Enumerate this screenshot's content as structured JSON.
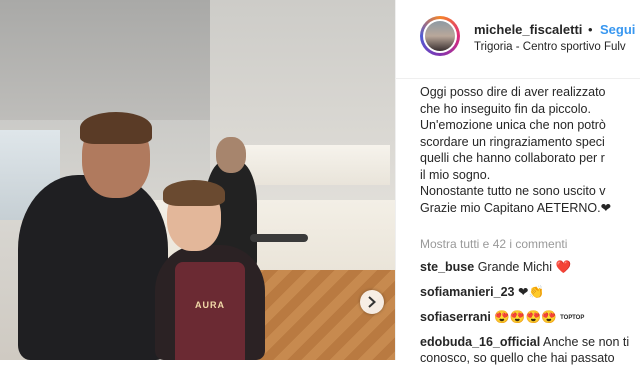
{
  "post": {
    "photo": {
      "shirt_text": "AURA",
      "next_icon": "chevron-right-icon"
    },
    "header": {
      "username": "michele_fiscaletti",
      "separator": "•",
      "follow_label": "Segui",
      "location": "Trigoria - Centro sportivo Fulv"
    },
    "caption": {
      "lines": [
        "Oggi posso dire di aver realizzato",
        "che ho inseguito fin da piccolo.",
        "Un'emozione unica che non potrò",
        "scordare un ringraziamento speci",
        "quelli che hanno collaborato per r",
        "il mio sogno.",
        "Nonostante tutto ne sono uscito v",
        "Grazie mio Capitano AETERNO."
      ],
      "trailing_emoji": "❤"
    },
    "show_all_label": "Mostra tutti e 42 i commenti",
    "comments": [
      {
        "user": "ste_buse",
        "text": "Grande Michi",
        "emoji": "❤️"
      },
      {
        "user": "sofiamanieri_23",
        "text": "❤",
        "emoji": "👏"
      },
      {
        "user": "sofiaserrani",
        "text": "😍😍😍😍",
        "badge": "TOP",
        "badge2": "TOP"
      },
      {
        "user": "edobuda_16_official",
        "text": "Anche se non ti",
        "emoji": ""
      },
      {
        "user": "",
        "text": "conosco, so quello che hai passato",
        "emoji": ""
      }
    ],
    "colors": {
      "link_blue": "#3897f0",
      "text": "#262626",
      "muted": "#999999"
    }
  }
}
